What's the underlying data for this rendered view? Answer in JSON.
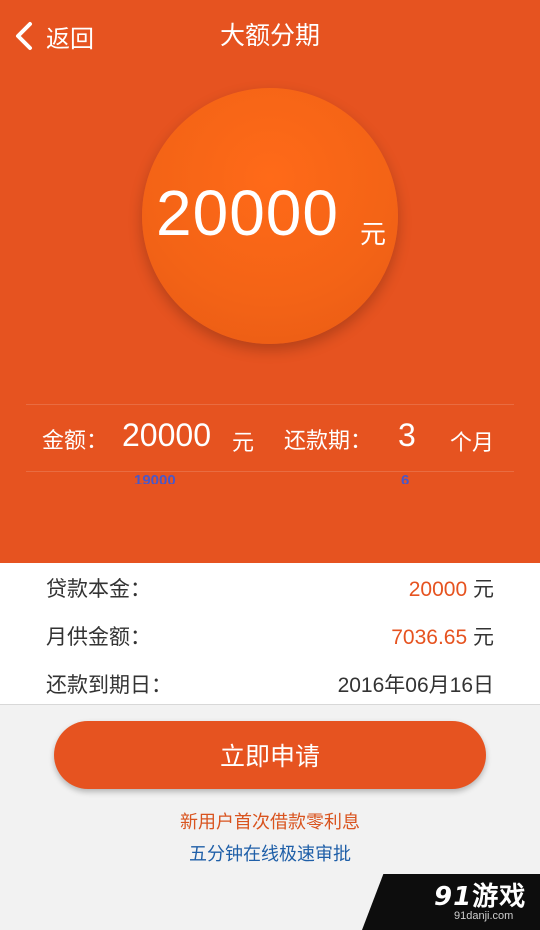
{
  "header": {
    "back_label": "返回",
    "title": "大额分期"
  },
  "hero": {
    "amount": "20000",
    "unit": "元"
  },
  "selector": {
    "amount_label": "金额：",
    "amount_value": "20000",
    "amount_unit": "元",
    "amount_next": "19000",
    "term_label": "还款期：",
    "term_value": "3",
    "term_unit": "个月",
    "term_next": "6"
  },
  "details": {
    "principal_label": "贷款本金：",
    "principal_value": "20000",
    "principal_unit": " 元",
    "monthly_label": "月供金额：",
    "monthly_value": "7036.65",
    "monthly_unit": " 元",
    "due_label": "还款到期日：",
    "due_value": "2016年06月16日"
  },
  "apply_button": "立即申请",
  "promo": {
    "line1": "新用户首次借款零利息",
    "line2": "五分钟在线极速审批"
  },
  "watermark": {
    "logo_num": "91",
    "logo_text": "游戏",
    "url": "91danji.com"
  },
  "colors": {
    "primary": "#e65320",
    "circle": "#f36316",
    "link_blue": "#1f5fa8"
  }
}
